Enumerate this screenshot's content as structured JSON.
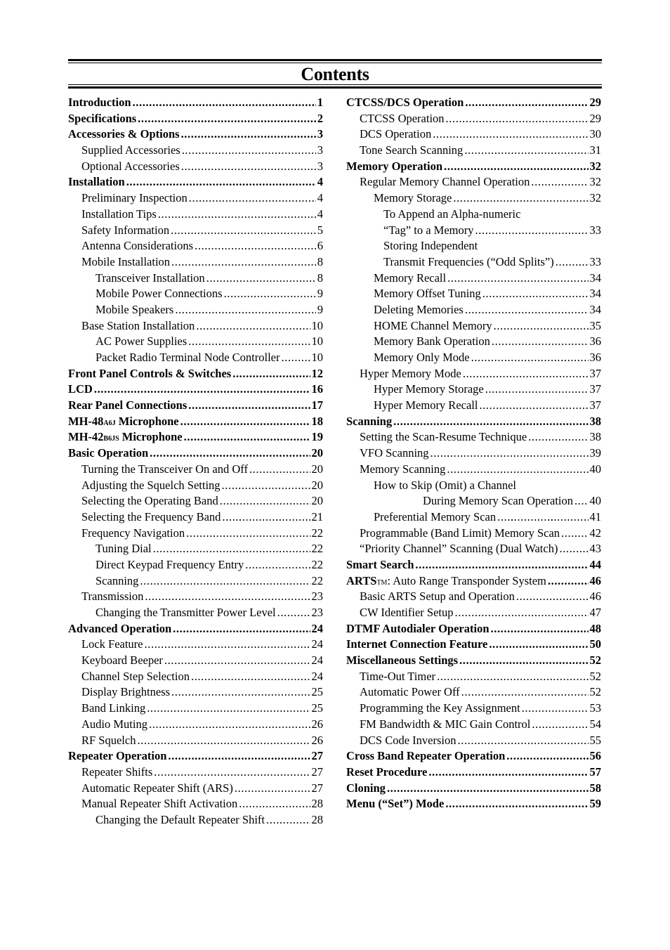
{
  "title": "Contents",
  "left_column": [
    {
      "label": "Introduction",
      "page": "1",
      "level": 0
    },
    {
      "label": "Specifications",
      "page": "2",
      "level": 0
    },
    {
      "label": "Accessories & Options",
      "page": "3",
      "level": 0
    },
    {
      "label": "Supplied Accessories",
      "page": "3",
      "level": 1
    },
    {
      "label": "Optional Accessories",
      "page": "3",
      "level": 1
    },
    {
      "label": "Installation",
      "page": "4",
      "level": 0
    },
    {
      "label": "Preliminary Inspection",
      "page": "4",
      "level": 1
    },
    {
      "label": "Installation Tips",
      "page": "4",
      "level": 1
    },
    {
      "label": "Safety Information",
      "page": "5",
      "level": 1
    },
    {
      "label": "Antenna Considerations",
      "page": "6",
      "level": 1
    },
    {
      "label": "Mobile Installation",
      "page": "8",
      "level": 1
    },
    {
      "label": "Transceiver Installation",
      "page": "8",
      "level": 2
    },
    {
      "label": "Mobile Power Connections",
      "page": "9",
      "level": 2
    },
    {
      "label": "Mobile Speakers",
      "page": "9",
      "level": 2
    },
    {
      "label": "Base Station Installation",
      "page": "10",
      "level": 1
    },
    {
      "label": "AC Power Supplies",
      "page": "10",
      "level": 2
    },
    {
      "label": "Packet Radio Terminal Node Controller",
      "page": "10",
      "level": 2
    },
    {
      "label": "Front Panel Controls & Switches",
      "page": "12",
      "level": 0
    },
    {
      "label": "LCD",
      "page": "16",
      "level": 0
    },
    {
      "label": "Rear Panel Connections",
      "page": "17",
      "level": 0
    },
    {
      "label": "MH-48",
      "suffix_small": "A6J",
      "label_after": " Microphone",
      "page": "18",
      "level": 0
    },
    {
      "label": "MH-42",
      "suffix_small": "B6JS",
      "label_after": " Microphone",
      "page": "19",
      "level": 0
    },
    {
      "label": "Basic Operation",
      "page": "20",
      "level": 0
    },
    {
      "label": "Turning the Transceiver On and Off",
      "page": "20",
      "level": 1
    },
    {
      "label": "Adjusting the Squelch Setting",
      "page": "20",
      "level": 1
    },
    {
      "label": "Selecting the Operating Band",
      "page": "20",
      "level": 1
    },
    {
      "label": "Selecting the Frequency Band",
      "page": "21",
      "level": 1
    },
    {
      "label": "Frequency Navigation",
      "page": "22",
      "level": 1
    },
    {
      "label": "Tuning Dial",
      "page": "22",
      "level": 2
    },
    {
      "label": "Direct Keypad Frequency Entry",
      "page": "22",
      "level": 2
    },
    {
      "label": "Scanning",
      "page": "22",
      "level": 2
    },
    {
      "label": "Transmission",
      "page": "23",
      "level": 1
    },
    {
      "label": "Changing the Transmitter Power Level",
      "page": "23",
      "level": 2
    },
    {
      "label": "Advanced Operation",
      "page": "24",
      "level": 0
    },
    {
      "label": "Lock Feature",
      "page": "24",
      "level": 1
    },
    {
      "label": "Keyboard Beeper",
      "page": "24",
      "level": 1
    },
    {
      "label": "Channel Step Selection",
      "page": "24",
      "level": 1
    },
    {
      "label": "Display Brightness",
      "page": "25",
      "level": 1
    },
    {
      "label": "Band Linking",
      "page": "25",
      "level": 1
    },
    {
      "label": "Audio Muting",
      "page": "26",
      "level": 1
    },
    {
      "label": "RF Squelch",
      "page": "26",
      "level": 1
    },
    {
      "label": "Repeater Operation",
      "page": "27",
      "level": 0
    },
    {
      "label": "Repeater Shifts",
      "page": "27",
      "level": 1
    },
    {
      "label": "Automatic Repeater Shift (ARS)",
      "page": "27",
      "level": 1
    },
    {
      "label": "Manual Repeater Shift Activation",
      "page": "28",
      "level": 1
    },
    {
      "label": "Changing the Default Repeater Shift",
      "page": "28",
      "level": 2
    }
  ],
  "right_column": [
    {
      "label": "CTCSS/DCS Operation",
      "page": "29",
      "level": 0
    },
    {
      "label": "CTCSS Operation",
      "page": "29",
      "level": 1
    },
    {
      "label": "DCS Operation",
      "page": "30",
      "level": 1
    },
    {
      "label": "Tone Search Scanning",
      "page": "31",
      "level": 1
    },
    {
      "label": "Memory Operation",
      "page": "32",
      "level": 0
    },
    {
      "label": "Regular Memory Channel Operation",
      "page": "32",
      "level": 1
    },
    {
      "label": "Memory Storage",
      "page": "32",
      "level": 2
    },
    {
      "label": "To Append an Alpha-numeric",
      "page": "",
      "level": 3
    },
    {
      "label": "“Tag” to a Memory",
      "page": "33",
      "level": 3
    },
    {
      "label": "Storing Independent",
      "page": "",
      "level": 3
    },
    {
      "label": "Transmit Frequencies (“Odd Splits”)",
      "page": "33",
      "level": 3
    },
    {
      "label": "Memory Recall",
      "page": "34",
      "level": 2
    },
    {
      "label": "Memory Offset Tuning",
      "page": "34",
      "level": 2
    },
    {
      "label": "Deleting Memories",
      "page": "34",
      "level": 2
    },
    {
      "label": "HOME Channel Memory",
      "page": "35",
      "level": 2
    },
    {
      "label": "Memory Bank Operation",
      "page": "36",
      "level": 2
    },
    {
      "label": "Memory Only Mode",
      "page": "36",
      "level": 2
    },
    {
      "label": "Hyper Memory Mode",
      "page": "37",
      "level": 1
    },
    {
      "label": "Hyper Memory Storage",
      "page": "37",
      "level": 2
    },
    {
      "label": "Hyper Memory Recall",
      "page": "37",
      "level": 2
    },
    {
      "label": "Scanning",
      "page": "38",
      "level": 0
    },
    {
      "label": "Setting the Scan-Resume Technique",
      "page": "38",
      "level": 1
    },
    {
      "label": "VFO Scanning",
      "page": "39",
      "level": 1
    },
    {
      "label": "Memory Scanning",
      "page": "40",
      "level": 1
    },
    {
      "label": "How to Skip (Omit) a Channel",
      "page": "",
      "level": 2
    },
    {
      "label": "During Memory Scan Operation",
      "page": "40",
      "level": 4
    },
    {
      "label": "Preferential Memory Scan",
      "page": "41",
      "level": 2
    },
    {
      "label": "Programmable (Band Limit) Memory Scan",
      "page": "42",
      "level": 1
    },
    {
      "label": "“Priority Channel” Scanning (Dual Watch)",
      "page": "43",
      "level": 1
    },
    {
      "label": "Smart Search",
      "page": "44",
      "level": 0
    },
    {
      "label": "ARTS",
      "suffix_small": "TM",
      "label_after": ": Auto Range Transponder System",
      "after_normal": true,
      "page": "46",
      "level": 0
    },
    {
      "label": "Basic ARTS Setup and Operation",
      "page": "46",
      "level": 1
    },
    {
      "label": "CW Identifier Setup",
      "page": "47",
      "level": 1
    },
    {
      "label": "DTMF Autodialer Operation",
      "page": "48",
      "level": 0
    },
    {
      "label": "Internet Connection Feature",
      "page": "50",
      "level": 0
    },
    {
      "label": "Miscellaneous Settings",
      "page": "52",
      "level": 0
    },
    {
      "label": "Time-Out Timer",
      "page": "52",
      "level": 1
    },
    {
      "label": "Automatic Power Off",
      "page": "52",
      "level": 1
    },
    {
      "label": "Programming the Key Assignment",
      "page": "53",
      "level": 1
    },
    {
      "label": "FM Bandwidth & MIC Gain Control",
      "page": "54",
      "level": 1
    },
    {
      "label": "DCS Code Inversion",
      "page": "55",
      "level": 1
    },
    {
      "label": "Cross Band Repeater Operation",
      "page": "56",
      "level": 0
    },
    {
      "label": "Reset Procedure",
      "page": "57",
      "level": 0
    },
    {
      "label": "Cloning",
      "page": "58",
      "level": 0
    },
    {
      "label": "Menu (“Set”) Mode",
      "page": "59",
      "level": 0
    }
  ]
}
